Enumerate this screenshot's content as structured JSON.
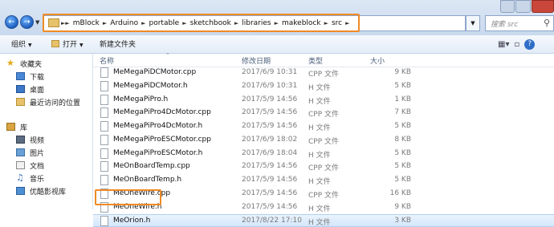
{
  "address": {
    "crumbs": [
      "mBlock",
      "Arduino",
      "portable",
      "sketchbook",
      "libraries",
      "makeblock",
      "src"
    ],
    "search_placeholder": "搜索 src"
  },
  "toolbar": {
    "organize": "组织",
    "open": "打开",
    "new_folder": "新建文件夹"
  },
  "nav": {
    "favorites": "收藏夹",
    "downloads": "下载",
    "desktop": "桌面",
    "recent": "最近访问的位置",
    "libraries": "库",
    "videos": "视频",
    "pictures": "图片",
    "documents": "文档",
    "music": "音乐",
    "youku": "优酷影视库"
  },
  "columns": {
    "name": "名称",
    "date": "修改日期",
    "type": "类型",
    "size": "大小"
  },
  "files": [
    {
      "name": "MeMegaPiDCMotor.cpp",
      "date": "2017/6/9 10:31",
      "type": "CPP 文件",
      "size": "9 KB"
    },
    {
      "name": "MeMegaPiDCMotor.h",
      "date": "2017/6/9 10:31",
      "type": "H 文件",
      "size": "5 KB"
    },
    {
      "name": "MeMegaPiPro.h",
      "date": "2017/5/9 14:56",
      "type": "H 文件",
      "size": "1 KB"
    },
    {
      "name": "MeMegaPiPro4DcMotor.cpp",
      "date": "2017/5/9 14:56",
      "type": "CPP 文件",
      "size": "7 KB"
    },
    {
      "name": "MeMegaPiPro4DcMotor.h",
      "date": "2017/5/9 14:56",
      "type": "H 文件",
      "size": "5 KB"
    },
    {
      "name": "MeMegaPiProESCMotor.cpp",
      "date": "2017/6/9 18:02",
      "type": "CPP 文件",
      "size": "8 KB"
    },
    {
      "name": "MeMegaPiProESCMotor.h",
      "date": "2017/6/9 18:04",
      "type": "H 文件",
      "size": "5 KB"
    },
    {
      "name": "MeOnBoardTemp.cpp",
      "date": "2017/5/9 14:56",
      "type": "CPP 文件",
      "size": "5 KB"
    },
    {
      "name": "MeOnBoardTemp.h",
      "date": "2017/5/9 14:56",
      "type": "H 文件",
      "size": "5 KB"
    },
    {
      "name": "MeOneWire.cpp",
      "date": "2017/5/9 14:56",
      "type": "CPP 文件",
      "size": "16 KB"
    },
    {
      "name": "MeOneWire.h",
      "date": "2017/5/9 14:56",
      "type": "H 文件",
      "size": "9 KB"
    },
    {
      "name": "MeOrion.h",
      "date": "2017/8/22 17:10",
      "type": "H 文件",
      "size": "3 KB"
    }
  ],
  "colors": {
    "highlight": "#f08a24",
    "selection": "#d4e7fb",
    "folder": "#e8c26a"
  }
}
